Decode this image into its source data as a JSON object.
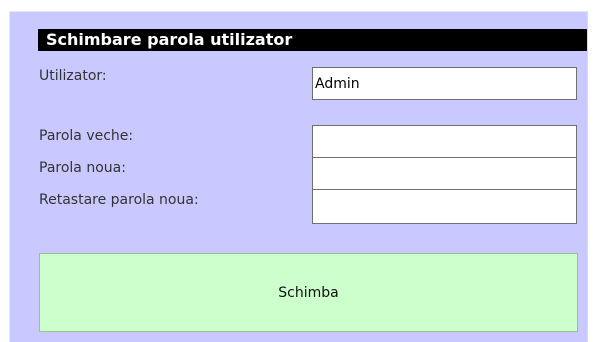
{
  "form": {
    "title": "Schimbare parola utilizator",
    "user_label": "Utilizator:",
    "user_value": "Admin",
    "old_password_label": "Parola veche:",
    "old_password_value": "",
    "new_password_label": "Parola noua:",
    "new_password_value": "",
    "confirm_password_label": "Retastare parola noua:",
    "confirm_password_value": "",
    "submit_label": "Schimba"
  },
  "colors": {
    "panel_background": "#c9c9ff",
    "title_background": "#000000",
    "button_background": "#ccffcc"
  }
}
